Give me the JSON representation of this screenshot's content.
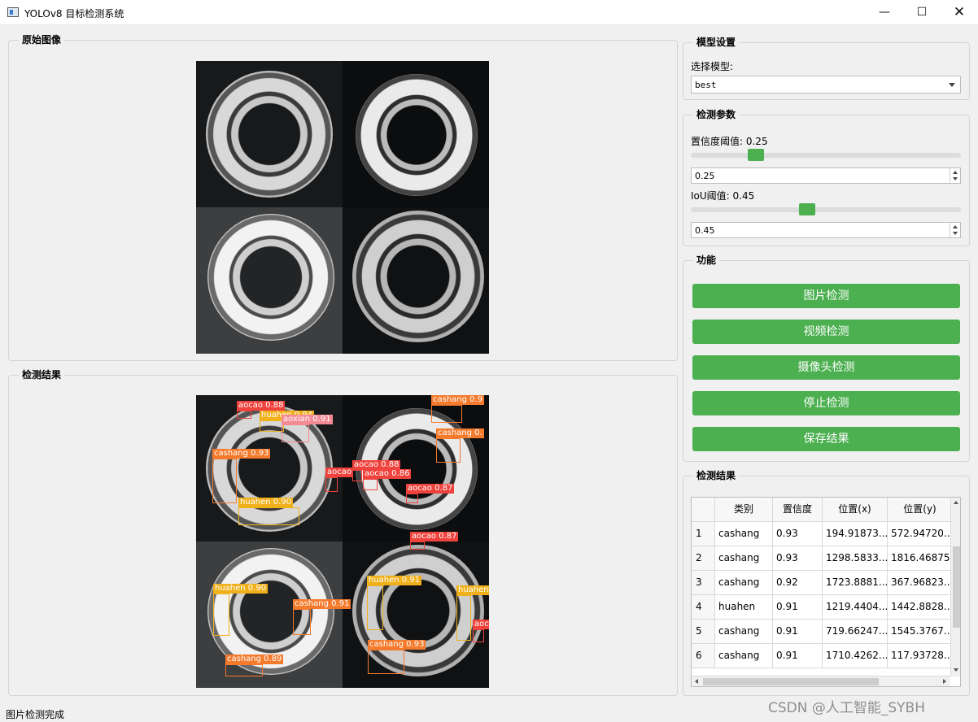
{
  "window": {
    "title": "YOLOv8 目标检测系统",
    "minimize": "—",
    "maximize": "☐",
    "close": "✕"
  },
  "original": {
    "title": "原始图像"
  },
  "result": {
    "title": "检测结果"
  },
  "model": {
    "title": "模型设置",
    "label": "选择模型:",
    "selected": "best"
  },
  "params": {
    "title": "检测参数",
    "conf_label": "置信度阈值: 0.25",
    "conf_value": "0.25",
    "conf_level": 0.25,
    "iou_label": "IoU阈值: 0.45",
    "iou_value": "0.45",
    "iou_level": 0.45
  },
  "functions": {
    "title": "功能",
    "image_detect": "图片检测",
    "video_detect": "视频检测",
    "camera_detect": "摄像头检测",
    "stop_detect": "停止检测",
    "save_result": "保存结果"
  },
  "results_table": {
    "title": "检测结果",
    "headers": [
      "类别",
      "置信度",
      "位置(x)",
      "位置(y)"
    ],
    "rows": [
      {
        "n": "1",
        "cls": "cashang",
        "conf": "0.93",
        "x": "194.91873...",
        "y": "572.94720..."
      },
      {
        "n": "2",
        "cls": "cashang",
        "conf": "0.93",
        "x": "1298.5833...",
        "y": "1816.46875"
      },
      {
        "n": "3",
        "cls": "cashang",
        "conf": "0.92",
        "x": "1723.8881...",
        "y": "367.96823..."
      },
      {
        "n": "4",
        "cls": "huahen",
        "conf": "0.91",
        "x": "1219.4404...",
        "y": "1442.8828..."
      },
      {
        "n": "5",
        "cls": "cashang",
        "conf": "0.91",
        "x": "719.66247...",
        "y": "1545.3767..."
      },
      {
        "n": "6",
        "cls": "cashang",
        "conf": "0.91",
        "x": "1710.4262...",
        "y": "117.93728..."
      }
    ]
  },
  "detections": [
    {
      "label": "aocao 0.88",
      "color": "#f0423c"
    },
    {
      "label": "huahen 0.94",
      "color": "#f0b01a"
    },
    {
      "label": "aoxian 0.91",
      "color": "#f48b94"
    },
    {
      "label": "cashang 0.93",
      "color": "#f47a2c"
    },
    {
      "label": "huahen 0.90",
      "color": "#f0b01a"
    },
    {
      "label": "aocao",
      "color": "#f0423c"
    },
    {
      "label": "cashang 0.9",
      "color": "#f47a2c"
    },
    {
      "label": "cashang 0.",
      "color": "#f47a2c"
    },
    {
      "label": "aocao 0.88",
      "color": "#f0423c"
    },
    {
      "label": "aocao 0.86",
      "color": "#f0423c"
    },
    {
      "label": "aocao 0.87",
      "color": "#f0423c"
    },
    {
      "label": "aocao 0.87",
      "color": "#f0423c"
    },
    {
      "label": "huahen 0.90",
      "color": "#f0b01a"
    },
    {
      "label": "cashang 0.91",
      "color": "#f47a2c"
    },
    {
      "label": "cashang 0.89",
      "color": "#f47a2c"
    },
    {
      "label": "huahen 0.91",
      "color": "#f0b01a"
    },
    {
      "label": "huahen",
      "color": "#f0b01a"
    },
    {
      "label": "cashang 0.93",
      "color": "#f47a2c"
    },
    {
      "label": "aoca",
      "color": "#f0423c"
    }
  ],
  "status": {
    "text": "图片检测完成"
  },
  "watermark": "CSDN @人工智能_SYBH",
  "colors": {
    "accent": "#4caf50"
  }
}
